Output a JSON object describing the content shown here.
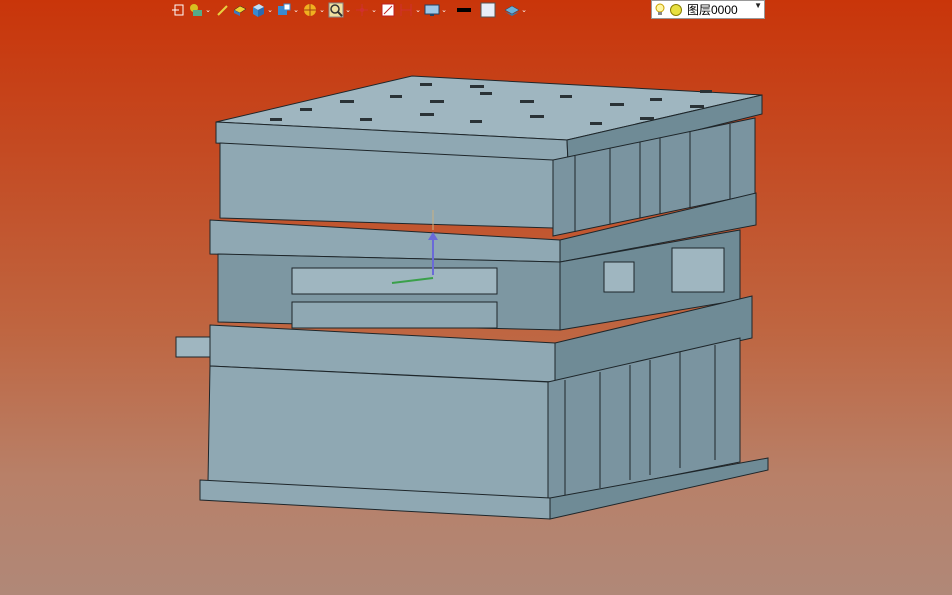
{
  "toolbar": {
    "items": [
      {
        "name": "exit-sketch-icon",
        "dropdown": false
      },
      {
        "name": "assembly-icon",
        "dropdown": true
      },
      {
        "name": "pencil-icon",
        "dropdown": false
      },
      {
        "name": "extrude-icon",
        "dropdown": false
      },
      {
        "name": "solid-box-icon",
        "dropdown": true
      },
      {
        "name": "view-cube-icon",
        "dropdown": true
      },
      {
        "name": "section-icon",
        "dropdown": true
      },
      {
        "name": "zoom-icon",
        "dropdown": true
      },
      {
        "name": "snap-icon",
        "dropdown": true
      },
      {
        "name": "frame-icon",
        "dropdown": false
      },
      {
        "name": "measure-icon",
        "dropdown": true
      },
      {
        "name": "display-icon",
        "dropdown": true
      },
      {
        "name": "line-color-icon",
        "dropdown": false
      },
      {
        "name": "fill-color-icon",
        "dropdown": false
      },
      {
        "name": "layer-icon",
        "dropdown": true
      }
    ],
    "layer_select": {
      "value": "图层0000"
    }
  },
  "colors": {
    "model": "#8fa8b3",
    "model_dark": "#6f8b96",
    "edge": "#1e262a"
  }
}
